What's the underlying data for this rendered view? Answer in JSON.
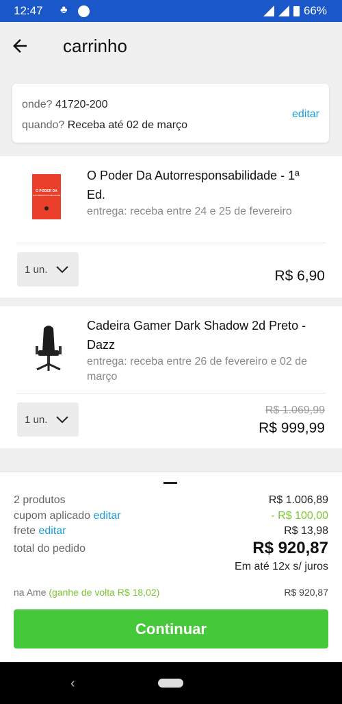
{
  "status_bar": {
    "time": "12:47",
    "notif_glyph": "♣",
    "battery": "66%"
  },
  "header": {
    "title": "carrinho",
    "back_icon": "arrow-back-icon"
  },
  "address": {
    "where_label": "onde?",
    "where_value": "41720-200",
    "when_label": "quando?",
    "when_value": "Receba até 02 de março",
    "edit_label": "editar"
  },
  "items": [
    {
      "name": "O Poder Da Autorresponsabilidade - 1ª Ed.",
      "delivery": "entrega: receba entre 24 e 25 de fevereiro",
      "quantity": "1 un.",
      "price": "R$ 6,90",
      "cover_line1": "O PODER DA",
      "cover_line2": "AUTORRESPONSABILIDADE"
    },
    {
      "name": "Cadeira Gamer Dark Shadow 2d Preto - Dazz",
      "delivery": "entrega: receba entre 26 de fevereiro e 02 de março",
      "quantity": "1 un.",
      "old_price": "R$ 1.069,99",
      "price": "R$ 999,99"
    }
  ],
  "summary": {
    "products_label": "2 produtos",
    "products_value": "R$ 1.006,89",
    "coupon_label": "cupom aplicado",
    "coupon_edit": "editar",
    "coupon_value": "- R$ 100,00",
    "shipping_label": "frete",
    "shipping_edit": "editar",
    "shipping_value": "R$ 13,98",
    "total_label": "total do pedido",
    "total_value": "R$ 920,87",
    "installments": "Em até 12x s/ juros",
    "ame_label": "na Ame",
    "ame_cashback": "(ganhe de volta R$ 18,02)",
    "ame_value": "R$ 920,87",
    "continue_label": "Continuar"
  },
  "nav": {
    "back_glyph": "‹"
  },
  "colors": {
    "status_bar": "#1a57c9",
    "link": "#1a9cd8",
    "green": "#45c93b",
    "discount": "#7cc531"
  }
}
